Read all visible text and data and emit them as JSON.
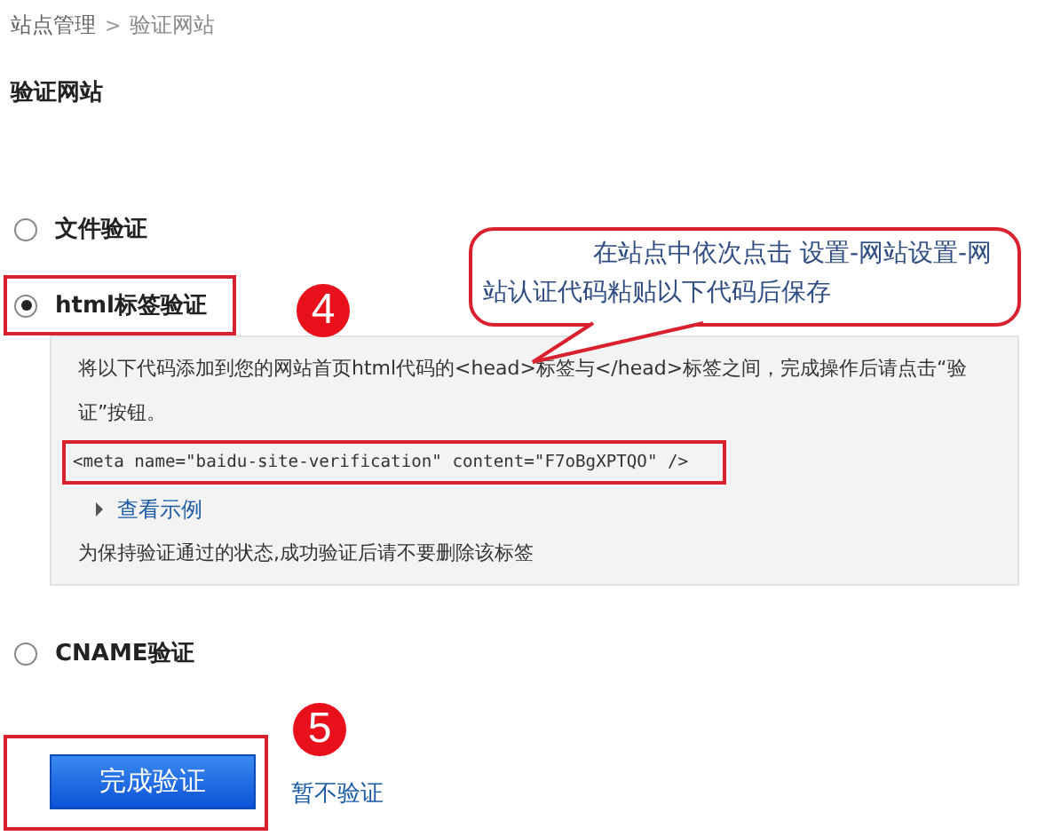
{
  "breadcrumb": [
    "站点管理",
    "验证网站"
  ],
  "breadcrumb_separator": ">",
  "title": "验证网站",
  "options": [
    {
      "kind": "plain",
      "label": "文件验证",
      "selected": false
    },
    {
      "kind": "panel",
      "label": "html标签验证",
      "selected": true,
      "highlighted": true,
      "panel": {
        "instruction": "将以下代码添加到您的网站首页html代码的<head>标签与</head>标签之间，完成操作后请点击“验证”按钮。",
        "code": "<meta name=\"baidu-site-verification\" content=\"F7oBgXPTQO\" />",
        "example_link": "查看示例",
        "note": "为保持验证通过的状态,成功验证后请不要删除该标签"
      }
    },
    {
      "kind": "plain",
      "label": "CNAME验证",
      "selected": false
    }
  ],
  "actions": {
    "primary": "完成验证",
    "secondary": "暂不验证"
  },
  "annotations": {
    "callout": "在站点中依次点击 设置-网站设置-网站认证代码粘贴以下代码后保存",
    "steps": [
      "4",
      "5"
    ]
  }
}
